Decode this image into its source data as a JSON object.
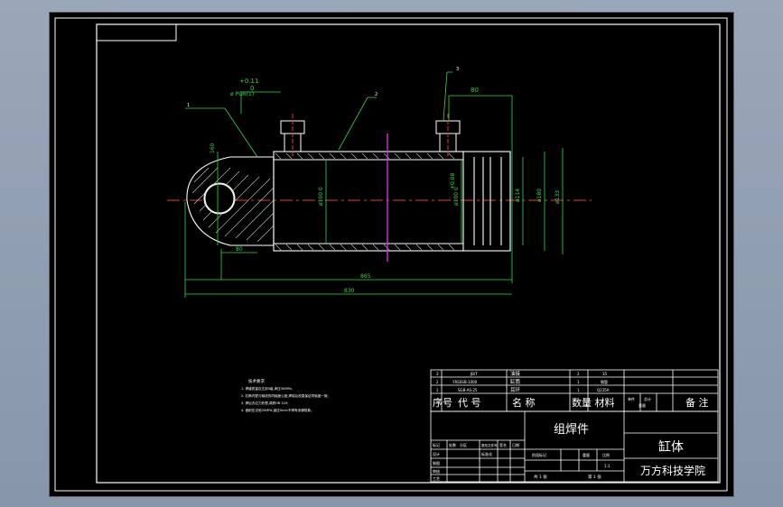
{
  "colors": {
    "background": "#000000",
    "frame": "#ffffff",
    "dimension": "#37d64a",
    "centerline": "#e33b3b",
    "section_plane": "#c83ad1",
    "part_outline": "#ffffff"
  },
  "drawing": {
    "balloons": [
      "1",
      "2",
      "3"
    ],
    "dim_fit_left": "+0.11",
    "dim_fit_left_zero": "0",
    "dim_port_left": "ø PG6(1)",
    "dim_port_right_len": "80",
    "dim_tol_top": "+0.08",
    "dim_bore": "ø100 0",
    "dim_inner": "ø100 0",
    "dim_seal": "ø114",
    "dim_out1": "ø180",
    "dim_out2": "ø133",
    "dim_lug_h": "160",
    "dim_lug_w": "80",
    "dim_span": "865",
    "dim_overall": "830"
  },
  "tech_notes": {
    "title": "技术要求",
    "lines": [
      "1. 焊缝质量应达到II级,承压30MPa;",
      "2. 缸筒内壁与轴线的同轴度公差,焊接后校直保证同轴度一致;",
      "3. 焊后去应力处理,调质HB 220;",
      "4. 做耐压试验30MPa,保压5min不得有渗漏现象。"
    ]
  },
  "bom": {
    "rows": [
      {
        "no": "3",
        "code": "JB/T",
        "name": "油接",
        "qty": "2",
        "material": "35"
      },
      {
        "no": "2",
        "code": "YRSSSB-1000",
        "name": "缸筒",
        "qty": "1",
        "material": "钢管"
      },
      {
        "no": "1",
        "code": "SGB-AS-25",
        "name": "耳环",
        "qty": "1",
        "material": "Q235A"
      }
    ],
    "header": {
      "no": "序号",
      "code": "代 号",
      "name": "名 称",
      "qty_mat": "数量 材料",
      "weight_a": "单件",
      "weight_b": "总计",
      "weight_c": "重量",
      "remark": "备 注"
    }
  },
  "title_block": {
    "assembly": "组焊件",
    "part_name": "缸体",
    "school": "万方科技学院",
    "mark": "标记",
    "count": "处数",
    "zone": "分区",
    "change_no": "更改文件号",
    "sign": "签名",
    "date": "日期",
    "designer": "设计",
    "standard": "标准化",
    "drafter": "制图",
    "checker": "审核",
    "craft": "工艺",
    "stage": "阶段标记",
    "weight": "重量",
    "scale": "比例",
    "scale_value": "1:1",
    "sheets": "共 1 张",
    "sheet": "第 1 张"
  }
}
